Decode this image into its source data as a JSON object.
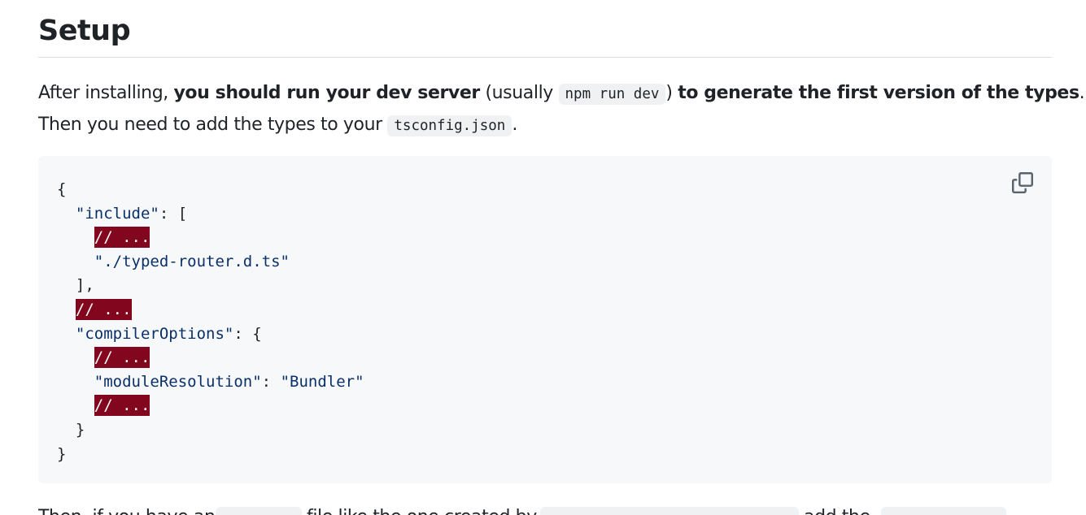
{
  "heading": "Setup",
  "intro": {
    "text1": "After installing, ",
    "bold1": "you should run your dev server",
    "text2": " (usually ",
    "code1": "npm run dev",
    "text3": ") ",
    "bold2": "to generate the first version of the types",
    "text4": ".",
    "text5": "Then you need to add the types to your ",
    "code2": "tsconfig.json",
    "text6": "."
  },
  "code_block": {
    "lines": {
      "l0": "{",
      "l1_indent": "  ",
      "l1_key": "\"include\"",
      "l1_rest": ": [",
      "l2_indent": "    ",
      "l2_comment": "// ...",
      "l3_indent": "    ",
      "l3_str": "\"./typed-router.d.ts\"",
      "l4": "  ],",
      "l5_indent": "  ",
      "l5_comment": "// ...",
      "l6_indent": "  ",
      "l6_key": "\"compilerOptions\"",
      "l6_rest": ": {",
      "l7_indent": "    ",
      "l7_comment": "// ...",
      "l8_indent": "    ",
      "l8_key": "\"moduleResolution\"",
      "l8_sep": ": ",
      "l8_val": "\"Bundler\"",
      "l9_indent": "    ",
      "l9_comment": "// ...",
      "l10": "  }",
      "l11": "}"
    },
    "copy_icon": "copy-icon"
  },
  "next_paragraph": {
    "partial_text_start": "Then, if you have an",
    "partial_text_mid": "file like the one created by",
    "partial_text_end": "add the"
  }
}
